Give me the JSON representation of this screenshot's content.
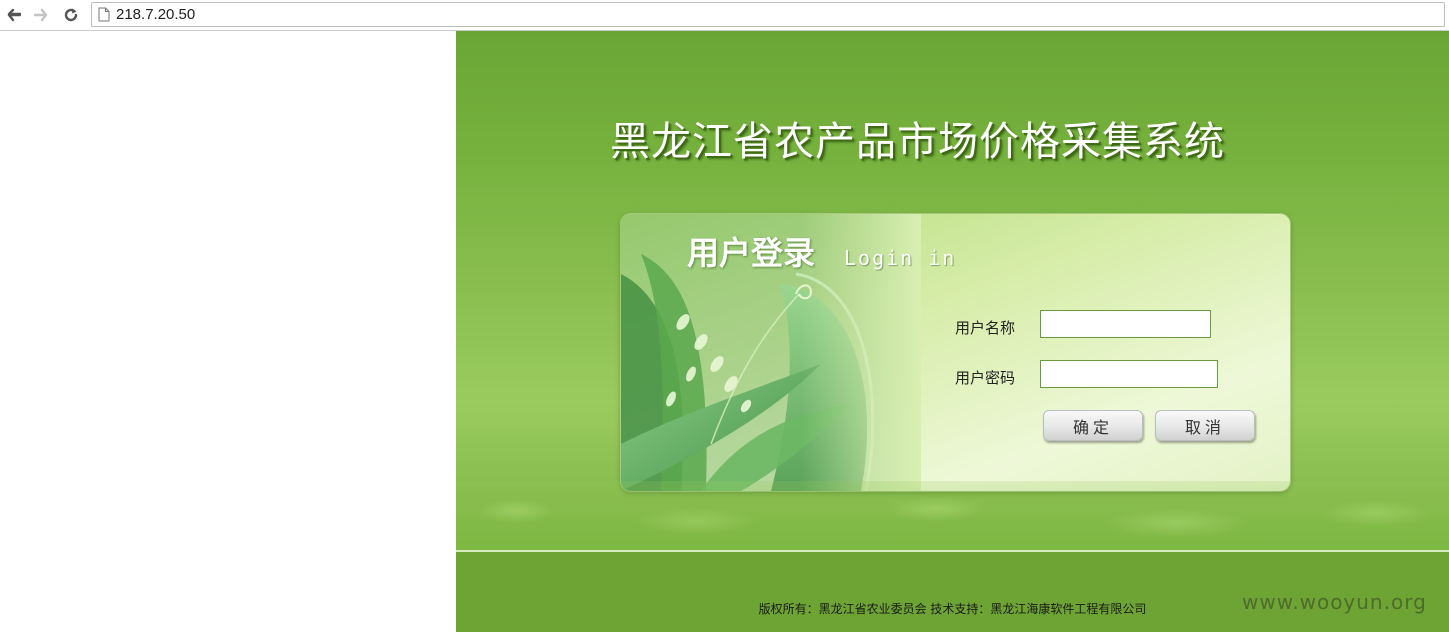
{
  "browser": {
    "url": "218.7.20.50",
    "icons": [
      "back-arrow-icon",
      "forward-arrow-icon",
      "reload-icon",
      "page-icon"
    ]
  },
  "page": {
    "title": "黑龙江省农产品市场价格采集系统",
    "login": {
      "heading": "用户登录",
      "subheading": "Login in",
      "username_label": "用户名称",
      "username_value": "",
      "password_label": "用户密码",
      "password_value": "",
      "confirm_label": "确定",
      "cancel_label": "取消"
    },
    "footer": {
      "copyright": "版权所有：黑龙江省农业委员会 技术支持：黑龙江海康软件工程有限公司"
    },
    "watermark": "www.wooyun.org"
  },
  "colors": {
    "panel_green": "#76b13d",
    "footer_green": "#6ea434",
    "title_shadow": "#3f6b14"
  }
}
